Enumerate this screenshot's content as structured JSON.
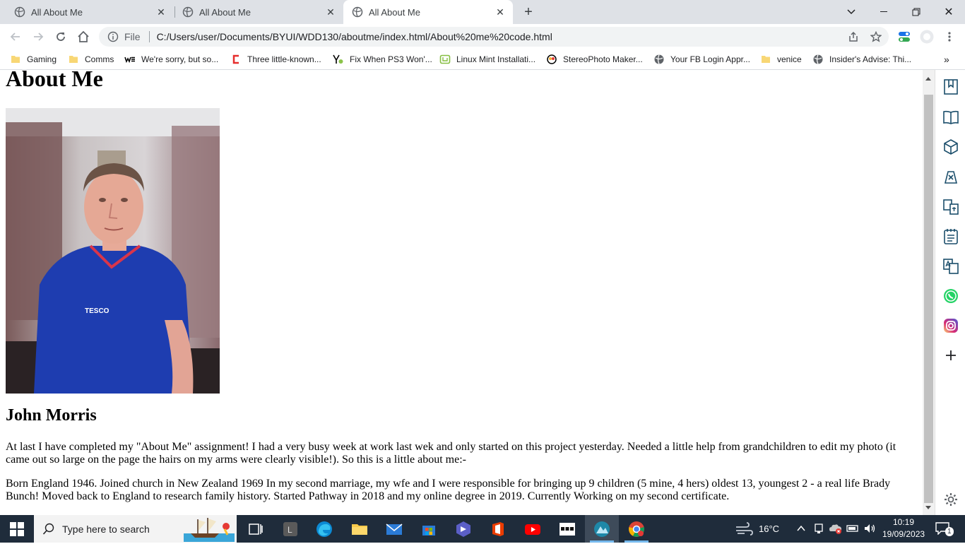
{
  "browser": {
    "tabs": [
      {
        "title": "All About Me",
        "active": false
      },
      {
        "title": "All About Me",
        "active": false
      },
      {
        "title": "All About Me",
        "active": true
      }
    ],
    "address_scheme": "File",
    "address_url": "C:/Users/user/Documents/BYUI/WDD130/aboutme/index.html/About%20me%20code.html",
    "bookmarks": [
      {
        "label": "Gaming",
        "icon": "folder-icon"
      },
      {
        "label": "Comms",
        "icon": "folder-icon"
      },
      {
        "label": "We're sorry, but so...",
        "icon": "we-logo-icon"
      },
      {
        "label": "Three little-known...",
        "icon": "c-logo-icon"
      },
      {
        "label": "Fix When PS3 Won'...",
        "icon": "yo-logo-icon"
      },
      {
        "label": "Linux Mint Installati...",
        "icon": "mint-logo-icon"
      },
      {
        "label": "StereoPhoto Maker...",
        "icon": "3d-logo-icon"
      },
      {
        "label": "Your FB Login Appr...",
        "icon": "globe-icon"
      },
      {
        "label": "venice",
        "icon": "folder-icon"
      },
      {
        "label": "Insider's Advise: Thi...",
        "icon": "globe-icon"
      }
    ]
  },
  "page": {
    "heading": "About Me",
    "photo_alt": "Portrait photo",
    "name": "John Morris",
    "paragraph1": "At last I have completed my \"About Me\" assignment! I had a very busy week at work last wek and only started on this project yesterday. Needed a little help from grandchildren to edit my photo (it came out so large on the page the hairs on my arms were clearly visible!). So this is a little about me:-",
    "paragraph2": "Born England 1946. Joined church in New Zealand 1969 In my second marriage, my wfe and I were responsible for bringing up 9 children (5 mine, 4 hers) oldest 13, youngest 2 - a real life Brady Bunch! Moved back to England to research family history. Started Pathway in 2018 and my online degree in 2019. Currently Working on my second certificate."
  },
  "taskbar": {
    "search_placeholder": "Type here to search",
    "temperature": "16°C",
    "time": "10:19",
    "date": "19/09/2023",
    "notification_count": "1"
  },
  "colors": {
    "tabstrip": "#dee1e6",
    "taskbar": "#1f2c3b",
    "shirt_blue": "#1e3db0"
  }
}
